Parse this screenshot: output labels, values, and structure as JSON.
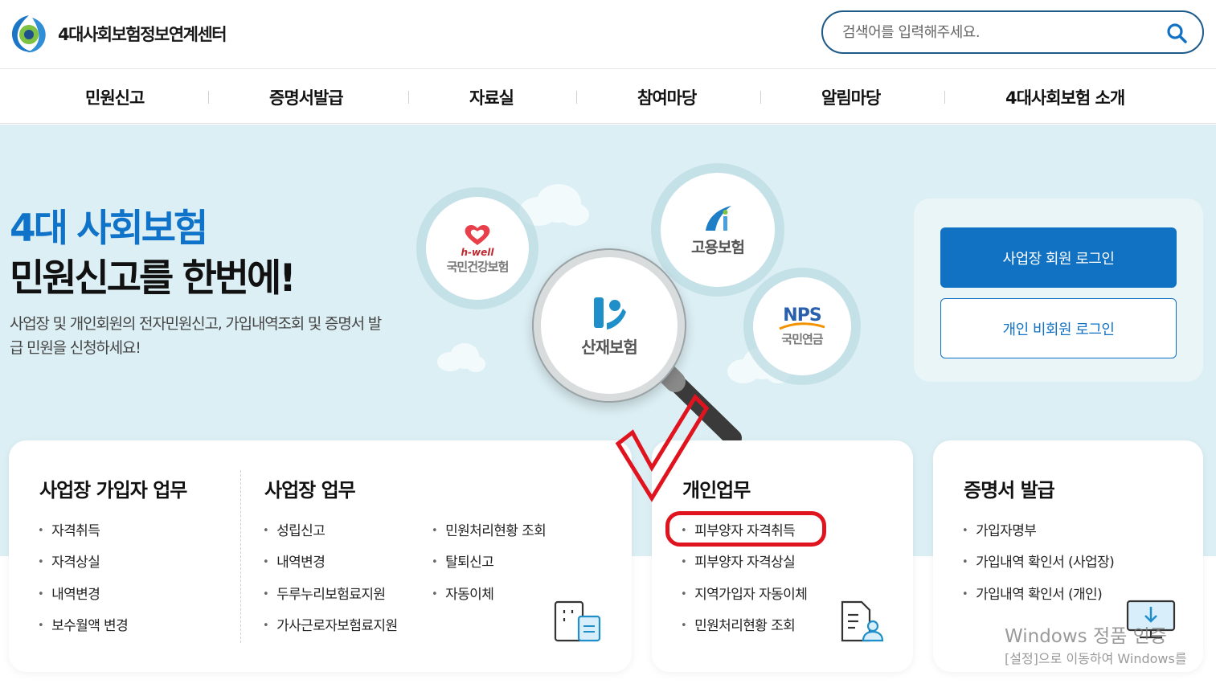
{
  "header": {
    "logo_text": "4대사회보험정보연계센터",
    "search_placeholder": "검색어를 입력해주세요."
  },
  "nav": [
    "민원신고",
    "증명서발급",
    "자료실",
    "참여마당",
    "알림마당",
    "4대사회보험 소개"
  ],
  "hero": {
    "title_line1": "4대 사회보험",
    "title_line2": "민원신고를 한번에!",
    "desc": "사업장 및 개인회원의 전자민원신고, 가입내역조회 및 증명서 발급 민원을 신청하세요!",
    "circles": {
      "health_brand": "h-well",
      "health_label": "국민건강보험",
      "employment_label": "고용보험",
      "accident_label": "산재보험",
      "pension_brand": "NPS",
      "pension_label": "국민연금"
    }
  },
  "login": {
    "business_login": "사업장 회원 로그인",
    "person_login": "개인 비회원 로그인"
  },
  "cards": {
    "subscriber": {
      "title": "사업장 가입자 업무",
      "items": [
        "자격취득",
        "자격상실",
        "내역변경",
        "보수월액 변경"
      ]
    },
    "business": {
      "title": "사업장 업무",
      "col1": [
        "성립신고",
        "내역변경",
        "두루누리보험료지원",
        "가사근로자보험료지원"
      ],
      "col2": [
        "민원처리현황 조회",
        "탈퇴신고",
        "자동이체"
      ]
    },
    "personal": {
      "title": "개인업무",
      "items": [
        "피부양자 자격취득",
        "피부양자 자격상실",
        "지역가입자 자동이체",
        "민원처리현황 조회"
      ]
    },
    "certificate": {
      "title": "증명서 발급",
      "items": [
        "가입자명부",
        "가입내역 확인서 (사업장)",
        "가입내역 확인서 (개인)"
      ]
    }
  },
  "watermark": {
    "line1": "Windows 정품 인증",
    "line2": "[설정]으로 이동하여 Windows를"
  },
  "colors": {
    "brand_blue": "#1172c4",
    "hero_bg": "#dceff4",
    "annotation_red": "#e0141e"
  }
}
